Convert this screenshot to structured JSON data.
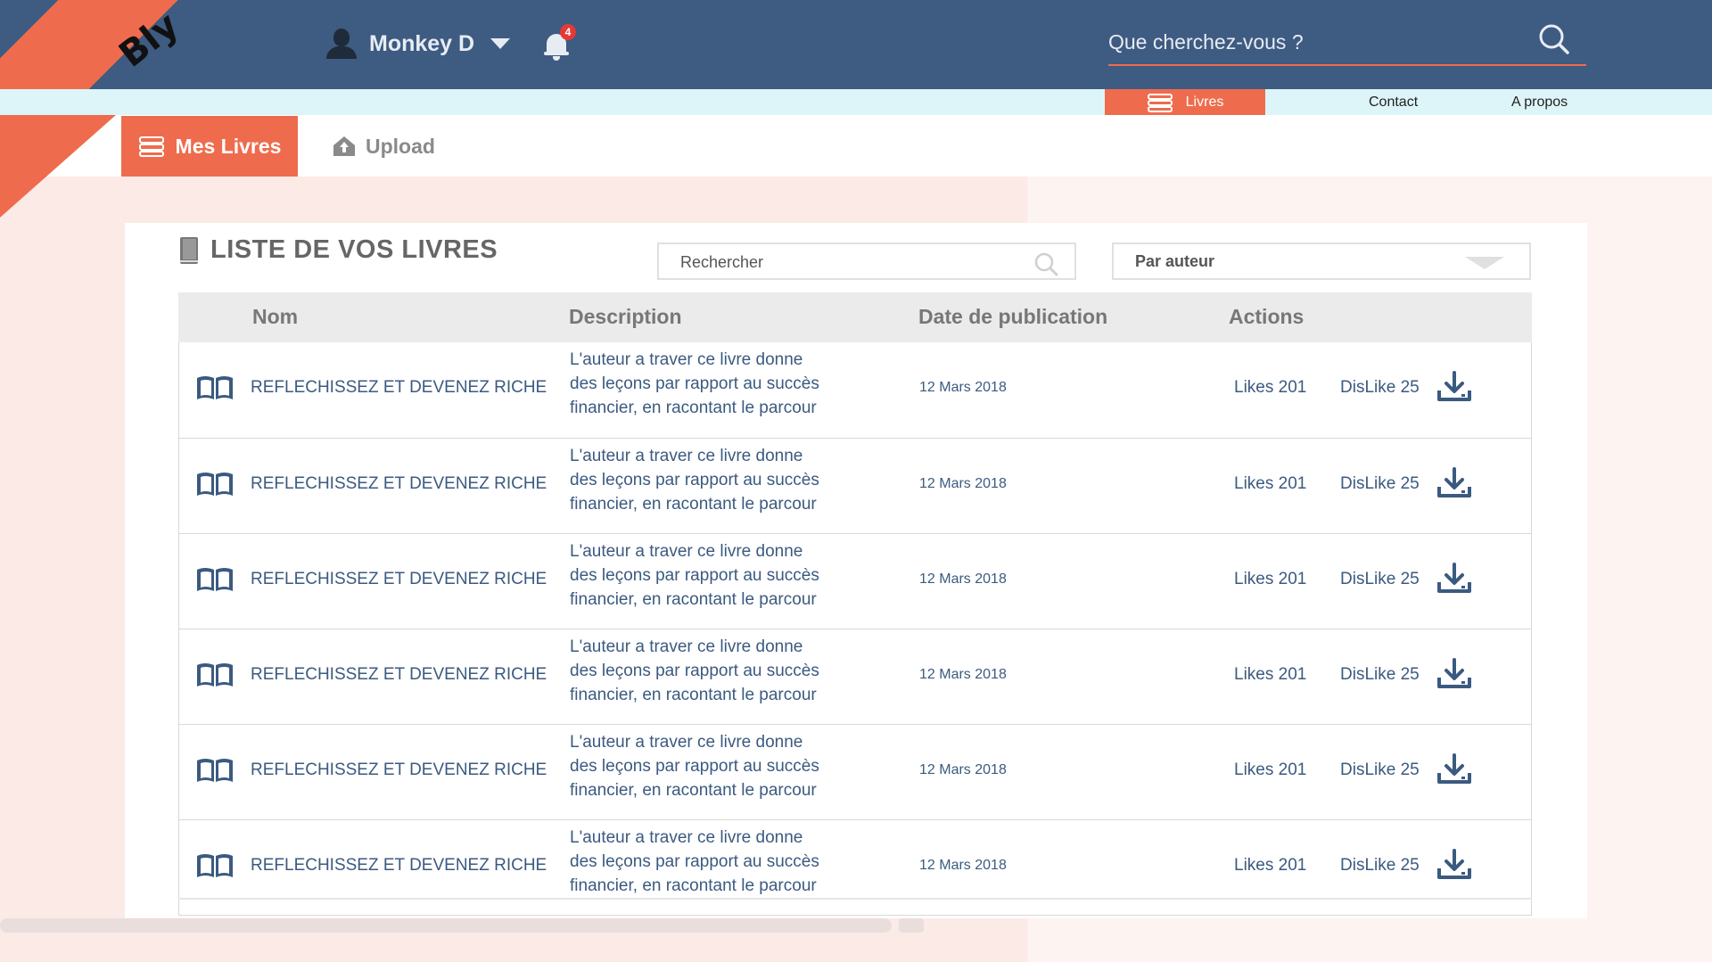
{
  "app": {
    "logo": "Bly"
  },
  "header": {
    "user_name": "Monkey D",
    "notification_count": "4",
    "search_placeholder": "Que cherchez-vous ?"
  },
  "nav": {
    "items": [
      {
        "label": "Livres",
        "active": true
      },
      {
        "label": "Contact",
        "active": false
      },
      {
        "label": "A propos",
        "active": false
      }
    ]
  },
  "tabs": [
    {
      "label": "Mes Livres",
      "active": true
    },
    {
      "label": "Upload",
      "active": false
    }
  ],
  "books_panel": {
    "title": "LISTE DE VOS LIVRES",
    "search_placeholder": "Rechercher",
    "filter_selected": "Par auteur",
    "columns": [
      "Nom",
      "Description",
      "Date de publication",
      "Actions"
    ],
    "rows": [
      {
        "name": "REFLECHISSEZ ET DEVENEZ RICHE",
        "desc": [
          "L'auteur a traver ce livre donne",
          " des leçons par rapport au succès",
          "financier, en racontant le parcour"
        ],
        "date": "12 Mars 2018",
        "likes": "Likes 201",
        "dislikes": "DisLike 25"
      },
      {
        "name": "REFLECHISSEZ ET DEVENEZ RICHE",
        "desc": [
          "L'auteur a traver ce livre donne",
          " des leçons par rapport au succès",
          "financier, en racontant le parcour"
        ],
        "date": "12 Mars 2018",
        "likes": "Likes 201",
        "dislikes": "DisLike 25"
      },
      {
        "name": "REFLECHISSEZ ET DEVENEZ RICHE",
        "desc": [
          "L'auteur a traver ce livre donne",
          " des leçons par rapport au succès",
          "financier, en racontant le parcour"
        ],
        "date": "12 Mars 2018",
        "likes": "Likes 201",
        "dislikes": "DisLike 25"
      },
      {
        "name": "REFLECHISSEZ ET DEVENEZ RICHE",
        "desc": [
          "L'auteur a traver ce livre donne",
          " des leçons par rapport au succès",
          "financier, en racontant le parcour"
        ],
        "date": "12 Mars 2018",
        "likes": "Likes 201",
        "dislikes": "DisLike 25"
      },
      {
        "name": "REFLECHISSEZ ET DEVENEZ RICHE",
        "desc": [
          "L'auteur a traver ce livre donne",
          " des leçons par rapport au succès",
          "financier, en racontant le parcour"
        ],
        "date": "12 Mars 2018",
        "likes": "Likes 201",
        "dislikes": "DisLike 25"
      },
      {
        "name": "REFLECHISSEZ ET DEVENEZ RICHE",
        "desc": [
          "L'auteur a traver ce livre donne",
          " des leçons par rapport au succès",
          "financier, en racontant le parcour"
        ],
        "date": "12 Mars 2018",
        "likes": "Likes 201",
        "dislikes": "DisLike 25"
      }
    ]
  },
  "colors": {
    "header_bg": "#3e5b82",
    "accent": "#ee6c4d",
    "nav_strip": "#ddf5f8",
    "text_blue": "#3b5a80"
  },
  "icons": [
    "user-icon",
    "chevron-down-icon",
    "bell-icon",
    "search-icon",
    "books-stack-icon",
    "upload-icon",
    "book-icon",
    "open-book-icon",
    "download-icon"
  ]
}
